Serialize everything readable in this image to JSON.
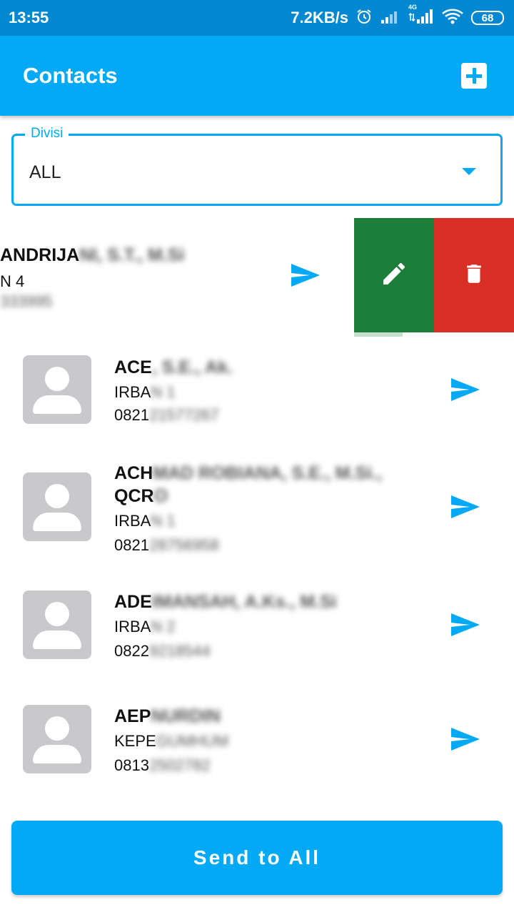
{
  "status_bar": {
    "time": "13:55",
    "speed": "7.2KB/s",
    "battery": "68",
    "network_label": "4G"
  },
  "appbar": {
    "title": "Contacts"
  },
  "filter": {
    "label": "Divisi",
    "value": "ALL"
  },
  "swiped_contact": {
    "name_visible": "ANDRIJA",
    "name_blurred": "NI, S.T., M.Si",
    "division_visible": "N 4",
    "phone_blurred": "333995"
  },
  "contacts": [
    {
      "name_visible": "ACE",
      "name_blurred": ", S.E., Ak.",
      "division_visible": "IRBA",
      "division_blurred": "N 1",
      "phone_visible": "0821",
      "phone_blurred": "21577267"
    },
    {
      "name_visible": "ACH",
      "name_blurred": "MAD ROBIANA, S.E., M.Si.,",
      "name_line2_visible": "QCR",
      "name_line2_blurred": "O",
      "division_visible": "IRBA",
      "division_blurred": "N 1",
      "phone_visible": "0821",
      "phone_blurred": "28756958"
    },
    {
      "name_visible": "ADE",
      "name_blurred": "IMANSAH, A.Ks., M.Si",
      "division_visible": "IRBA",
      "division_blurred": "N 2",
      "phone_visible": "0822",
      "phone_blurred": "9218544"
    },
    {
      "name_visible": "AEP",
      "name_blurred": "NURDIN",
      "division_visible": "KEPE",
      "division_blurred": "GUMHUM",
      "phone_visible": "0813",
      "phone_blurred": "2502782"
    }
  ],
  "actions": {
    "send_all": "Send to All"
  },
  "colors": {
    "primary": "#03A9F4",
    "status_bar": "#0288D1",
    "edit": "#1B7F3A",
    "delete": "#D93025",
    "avatar_bg": "#C9C9CC"
  }
}
